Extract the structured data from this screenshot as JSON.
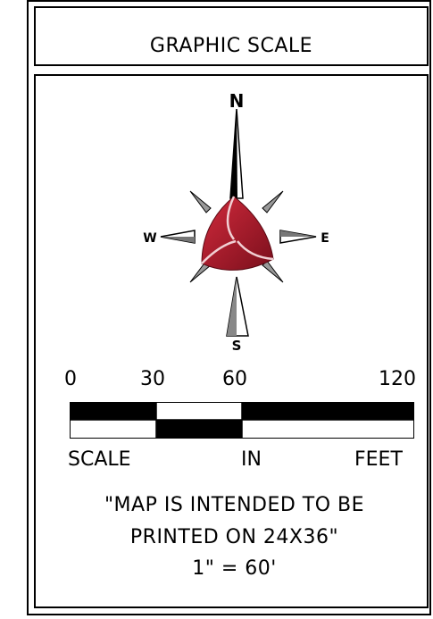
{
  "title": "GRAPHIC SCALE",
  "compass": {
    "north": "N",
    "south": "S",
    "east": "E",
    "west": "W",
    "accent": "#b01e2e"
  },
  "scale": {
    "ticks": [
      "0",
      "30",
      "60",
      "120"
    ],
    "labels": [
      "SCALE",
      "IN",
      "FEET"
    ]
  },
  "note": {
    "line1": "\"MAP IS INTENDED TO BE",
    "line2": "PRINTED ON 24X36\"",
    "line3": "1\" = 60'"
  }
}
